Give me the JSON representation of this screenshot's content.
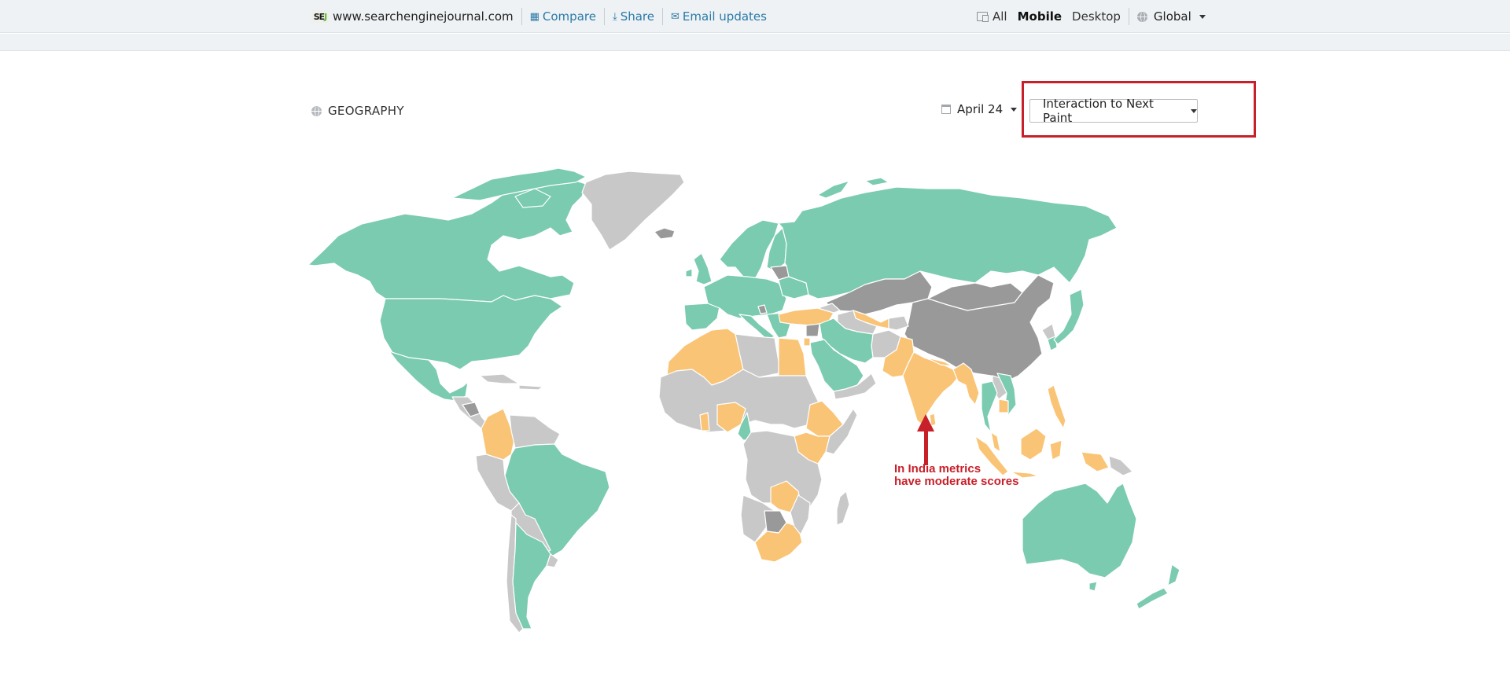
{
  "topbar": {
    "logo": {
      "prefix": "SE",
      "suffix": "J"
    },
    "domain": "www.searchenginejournal.com",
    "links": [
      {
        "label": "Compare",
        "icon": "grid-icon"
      },
      {
        "label": "Share",
        "icon": "download-icon"
      },
      {
        "label": "Email updates",
        "icon": "envelope-icon"
      }
    ],
    "device_filter": {
      "icon": "devices-icon",
      "options": [
        "All",
        "Mobile",
        "Desktop"
      ],
      "selected": "Mobile"
    },
    "region": {
      "icon": "globe-icon",
      "label": "Global"
    }
  },
  "section": {
    "title": "GEOGRAPHY",
    "icon": "globe-icon",
    "date": {
      "icon": "calendar-icon",
      "label": "April 24"
    },
    "metric_select": {
      "selected": "Interaction to Next Paint"
    }
  },
  "map": {
    "type": "choropleth",
    "metric": "Interaction to Next Paint",
    "legend_colors": {
      "good": "#7acbb0",
      "moderate": "#fac476",
      "no_data": "#c8c8c8",
      "insufficient": "#999999"
    },
    "regions": {
      "good": [
        "Canada",
        "United States",
        "Mexico",
        "Brazil",
        "Argentina",
        "Russia",
        "Western & Central Europe",
        "Scandinavia",
        "Iran",
        "Iraq",
        "Saudi Arabia",
        "Cameroon",
        "Thailand",
        "Vietnam",
        "South Korea",
        "Japan",
        "Taiwan",
        "Australia",
        "New Zealand"
      ],
      "moderate": [
        "India",
        "Pakistan",
        "Nepal",
        "Bangladesh",
        "Myanmar",
        "Cambodia",
        "Indonesia",
        "Philippines",
        "Malaysia",
        "Turkey",
        "Uzbekistan",
        "Egypt",
        "Algeria",
        "Morocco",
        "Tunisia",
        "Jordan",
        "Nigeria",
        "Ghana",
        "Ethiopia",
        "Kenya",
        "Uganda",
        "Zambia",
        "Zimbabwe",
        "South Africa",
        "Colombia"
      ],
      "insufficient": [
        "China",
        "Kazakhstan",
        "Mongolia",
        "Belarus",
        "Syria",
        "Iceland",
        "Botswana",
        "Nicaragua",
        "Bosnia"
      ],
      "no_data": [
        "Greenland",
        "Afghanistan",
        "Libya",
        "Chad",
        "Sudan",
        "DR Congo",
        "Angola",
        "Namibia",
        "Madagascar",
        "Peru",
        "Bolivia",
        "Venezuela",
        "Chile",
        "Paraguay",
        "Uruguay",
        "Papua New Guinea",
        "North Korea",
        "Laos",
        "Yemen",
        "Oman"
      ]
    }
  },
  "annotation": {
    "line1": "In India metrics",
    "line2": "have moderate scores",
    "color": "#c8202a"
  }
}
